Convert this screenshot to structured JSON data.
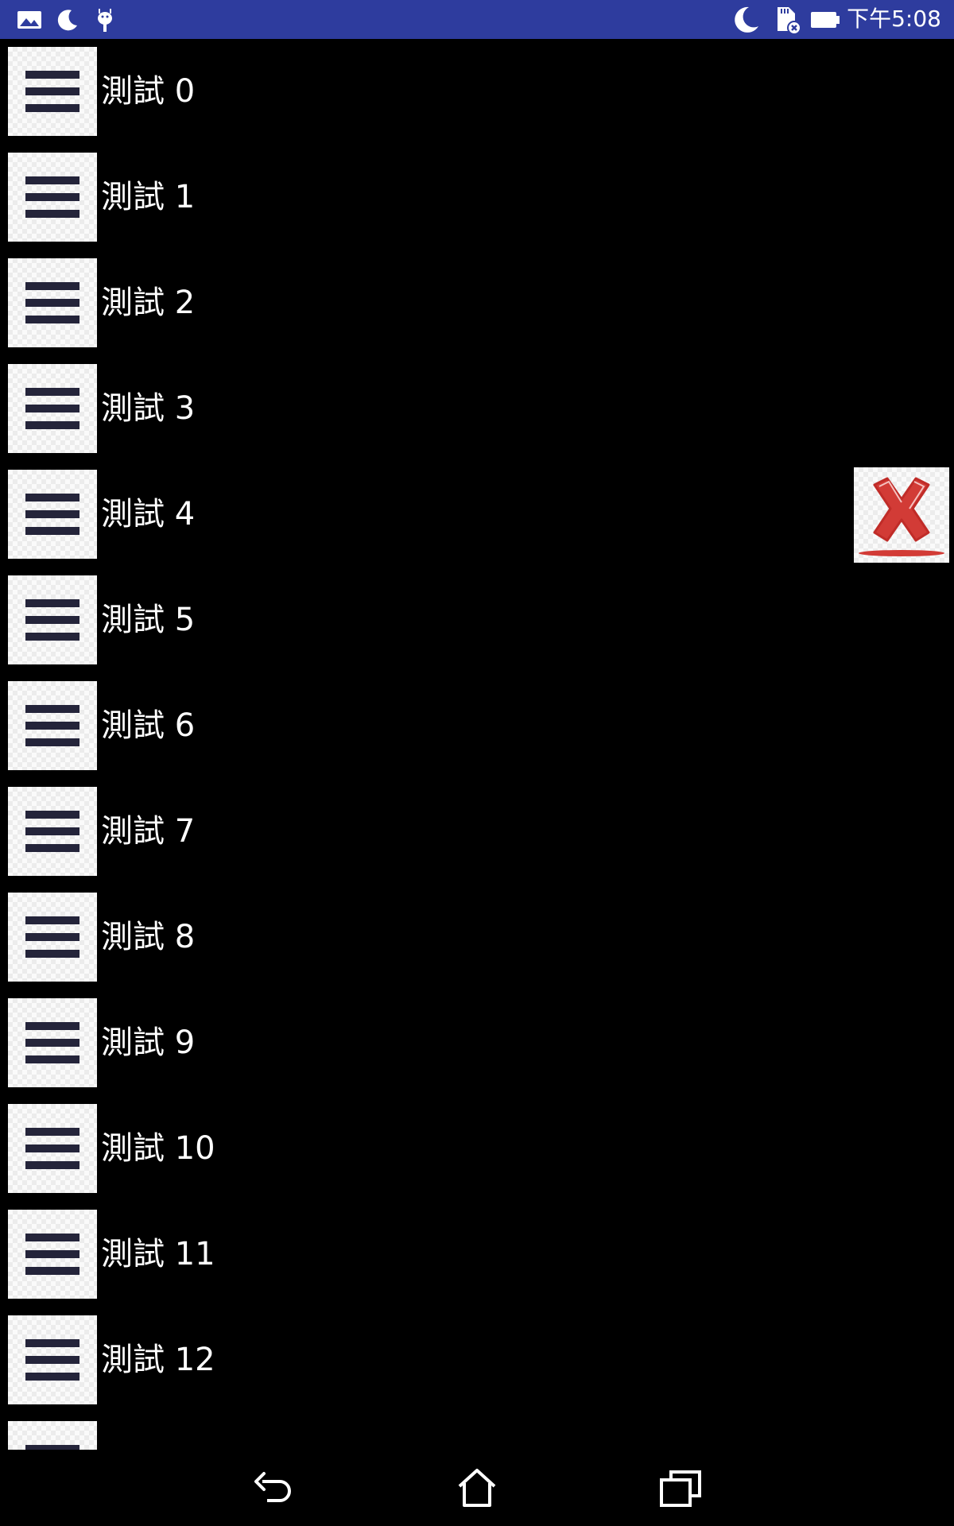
{
  "status_bar": {
    "time": "下午5:08",
    "left_icons": [
      "gallery-icon",
      "moon-icon",
      "android-debug-icon"
    ],
    "right_icons": [
      "do-not-disturb-moon-icon",
      "sd-card-error-icon",
      "battery-icon"
    ],
    "background_color": "#2e3c9e"
  },
  "list": {
    "items": [
      {
        "label": "測試 0"
      },
      {
        "label": "測試 1"
      },
      {
        "label": "測試 2"
      },
      {
        "label": "測試 3"
      },
      {
        "label": "測試 4"
      },
      {
        "label": "測試 5"
      },
      {
        "label": "測試 6"
      },
      {
        "label": "測試 7"
      },
      {
        "label": "測試 8"
      },
      {
        "label": "測試 9"
      },
      {
        "label": "測試 10"
      },
      {
        "label": "測試 11"
      },
      {
        "label": "測試 12"
      },
      {
        "label": ""
      }
    ]
  },
  "floating_action": {
    "icon": "delete-x-icon",
    "color": "#d23b36"
  },
  "nav_bar": {
    "buttons": [
      "back-icon",
      "home-icon",
      "recents-icon"
    ]
  }
}
